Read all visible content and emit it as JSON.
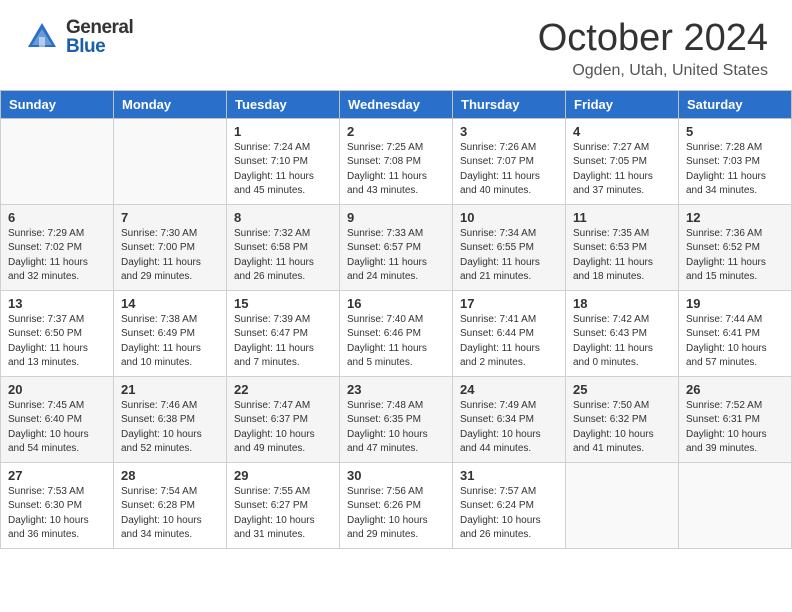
{
  "header": {
    "logo_general": "General",
    "logo_blue": "Blue",
    "month_title": "October 2024",
    "location": "Ogden, Utah, United States"
  },
  "calendar": {
    "days_of_week": [
      "Sunday",
      "Monday",
      "Tuesday",
      "Wednesday",
      "Thursday",
      "Friday",
      "Saturday"
    ],
    "weeks": [
      [
        {
          "day": "",
          "sunrise": "",
          "sunset": "",
          "daylight": ""
        },
        {
          "day": "",
          "sunrise": "",
          "sunset": "",
          "daylight": ""
        },
        {
          "day": "1",
          "sunrise": "Sunrise: 7:24 AM",
          "sunset": "Sunset: 7:10 PM",
          "daylight": "Daylight: 11 hours and 45 minutes."
        },
        {
          "day": "2",
          "sunrise": "Sunrise: 7:25 AM",
          "sunset": "Sunset: 7:08 PM",
          "daylight": "Daylight: 11 hours and 43 minutes."
        },
        {
          "day": "3",
          "sunrise": "Sunrise: 7:26 AM",
          "sunset": "Sunset: 7:07 PM",
          "daylight": "Daylight: 11 hours and 40 minutes."
        },
        {
          "day": "4",
          "sunrise": "Sunrise: 7:27 AM",
          "sunset": "Sunset: 7:05 PM",
          "daylight": "Daylight: 11 hours and 37 minutes."
        },
        {
          "day": "5",
          "sunrise": "Sunrise: 7:28 AM",
          "sunset": "Sunset: 7:03 PM",
          "daylight": "Daylight: 11 hours and 34 minutes."
        }
      ],
      [
        {
          "day": "6",
          "sunrise": "Sunrise: 7:29 AM",
          "sunset": "Sunset: 7:02 PM",
          "daylight": "Daylight: 11 hours and 32 minutes."
        },
        {
          "day": "7",
          "sunrise": "Sunrise: 7:30 AM",
          "sunset": "Sunset: 7:00 PM",
          "daylight": "Daylight: 11 hours and 29 minutes."
        },
        {
          "day": "8",
          "sunrise": "Sunrise: 7:32 AM",
          "sunset": "Sunset: 6:58 PM",
          "daylight": "Daylight: 11 hours and 26 minutes."
        },
        {
          "day": "9",
          "sunrise": "Sunrise: 7:33 AM",
          "sunset": "Sunset: 6:57 PM",
          "daylight": "Daylight: 11 hours and 24 minutes."
        },
        {
          "day": "10",
          "sunrise": "Sunrise: 7:34 AM",
          "sunset": "Sunset: 6:55 PM",
          "daylight": "Daylight: 11 hours and 21 minutes."
        },
        {
          "day": "11",
          "sunrise": "Sunrise: 7:35 AM",
          "sunset": "Sunset: 6:53 PM",
          "daylight": "Daylight: 11 hours and 18 minutes."
        },
        {
          "day": "12",
          "sunrise": "Sunrise: 7:36 AM",
          "sunset": "Sunset: 6:52 PM",
          "daylight": "Daylight: 11 hours and 15 minutes."
        }
      ],
      [
        {
          "day": "13",
          "sunrise": "Sunrise: 7:37 AM",
          "sunset": "Sunset: 6:50 PM",
          "daylight": "Daylight: 11 hours and 13 minutes."
        },
        {
          "day": "14",
          "sunrise": "Sunrise: 7:38 AM",
          "sunset": "Sunset: 6:49 PM",
          "daylight": "Daylight: 11 hours and 10 minutes."
        },
        {
          "day": "15",
          "sunrise": "Sunrise: 7:39 AM",
          "sunset": "Sunset: 6:47 PM",
          "daylight": "Daylight: 11 hours and 7 minutes."
        },
        {
          "day": "16",
          "sunrise": "Sunrise: 7:40 AM",
          "sunset": "Sunset: 6:46 PM",
          "daylight": "Daylight: 11 hours and 5 minutes."
        },
        {
          "day": "17",
          "sunrise": "Sunrise: 7:41 AM",
          "sunset": "Sunset: 6:44 PM",
          "daylight": "Daylight: 11 hours and 2 minutes."
        },
        {
          "day": "18",
          "sunrise": "Sunrise: 7:42 AM",
          "sunset": "Sunset: 6:43 PM",
          "daylight": "Daylight: 11 hours and 0 minutes."
        },
        {
          "day": "19",
          "sunrise": "Sunrise: 7:44 AM",
          "sunset": "Sunset: 6:41 PM",
          "daylight": "Daylight: 10 hours and 57 minutes."
        }
      ],
      [
        {
          "day": "20",
          "sunrise": "Sunrise: 7:45 AM",
          "sunset": "Sunset: 6:40 PM",
          "daylight": "Daylight: 10 hours and 54 minutes."
        },
        {
          "day": "21",
          "sunrise": "Sunrise: 7:46 AM",
          "sunset": "Sunset: 6:38 PM",
          "daylight": "Daylight: 10 hours and 52 minutes."
        },
        {
          "day": "22",
          "sunrise": "Sunrise: 7:47 AM",
          "sunset": "Sunset: 6:37 PM",
          "daylight": "Daylight: 10 hours and 49 minutes."
        },
        {
          "day": "23",
          "sunrise": "Sunrise: 7:48 AM",
          "sunset": "Sunset: 6:35 PM",
          "daylight": "Daylight: 10 hours and 47 minutes."
        },
        {
          "day": "24",
          "sunrise": "Sunrise: 7:49 AM",
          "sunset": "Sunset: 6:34 PM",
          "daylight": "Daylight: 10 hours and 44 minutes."
        },
        {
          "day": "25",
          "sunrise": "Sunrise: 7:50 AM",
          "sunset": "Sunset: 6:32 PM",
          "daylight": "Daylight: 10 hours and 41 minutes."
        },
        {
          "day": "26",
          "sunrise": "Sunrise: 7:52 AM",
          "sunset": "Sunset: 6:31 PM",
          "daylight": "Daylight: 10 hours and 39 minutes."
        }
      ],
      [
        {
          "day": "27",
          "sunrise": "Sunrise: 7:53 AM",
          "sunset": "Sunset: 6:30 PM",
          "daylight": "Daylight: 10 hours and 36 minutes."
        },
        {
          "day": "28",
          "sunrise": "Sunrise: 7:54 AM",
          "sunset": "Sunset: 6:28 PM",
          "daylight": "Daylight: 10 hours and 34 minutes."
        },
        {
          "day": "29",
          "sunrise": "Sunrise: 7:55 AM",
          "sunset": "Sunset: 6:27 PM",
          "daylight": "Daylight: 10 hours and 31 minutes."
        },
        {
          "day": "30",
          "sunrise": "Sunrise: 7:56 AM",
          "sunset": "Sunset: 6:26 PM",
          "daylight": "Daylight: 10 hours and 29 minutes."
        },
        {
          "day": "31",
          "sunrise": "Sunrise: 7:57 AM",
          "sunset": "Sunset: 6:24 PM",
          "daylight": "Daylight: 10 hours and 26 minutes."
        },
        {
          "day": "",
          "sunrise": "",
          "sunset": "",
          "daylight": ""
        },
        {
          "day": "",
          "sunrise": "",
          "sunset": "",
          "daylight": ""
        }
      ]
    ]
  }
}
